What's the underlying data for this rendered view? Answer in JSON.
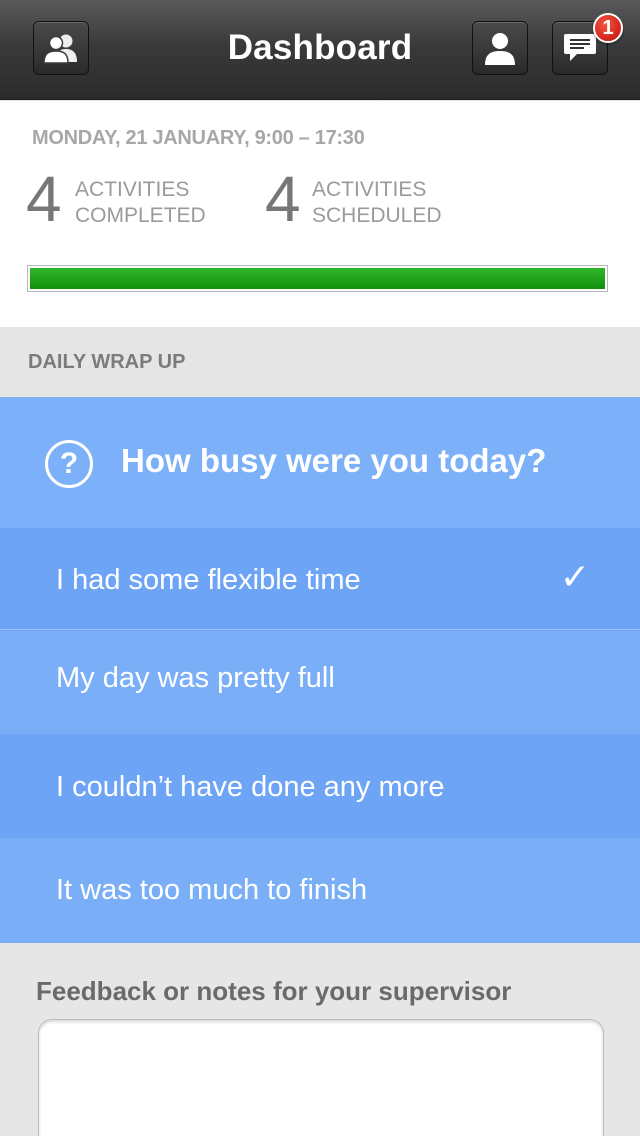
{
  "navbar": {
    "title": "Dashboard",
    "users_icon": "users-icon",
    "profile_icon": "profile-icon",
    "messages_icon": "chat-bubble-icon",
    "notification_count": "1"
  },
  "summary": {
    "date": "MONDAY,  21 JANUARY, 9:00 – 17:30",
    "completed_count": "4",
    "completed_label_1": "ACTIVITIES",
    "completed_label_2": "COMPLETED",
    "scheduled_count": "4",
    "scheduled_label_1": "ACTIVITIES",
    "scheduled_label_2": "SCHEDULED",
    "progress_fraction": 1.0,
    "progress_color": "#1ea31a"
  },
  "wrap_up": {
    "section_title": "DAILY WRAP UP",
    "question_icon": "question-circle-icon",
    "question": "How busy were you today?",
    "options": [
      {
        "label": "I had some flexible time",
        "selected": true
      },
      {
        "label": "My day was pretty full",
        "selected": false
      },
      {
        "label": "I couldn’t have done any more",
        "selected": false
      },
      {
        "label": "It was too much to finish",
        "selected": false
      }
    ],
    "check_glyph": "✓",
    "accent_color": "#6ea4f5"
  },
  "feedback": {
    "title": "Feedback or notes for your supervisor",
    "value": ""
  }
}
